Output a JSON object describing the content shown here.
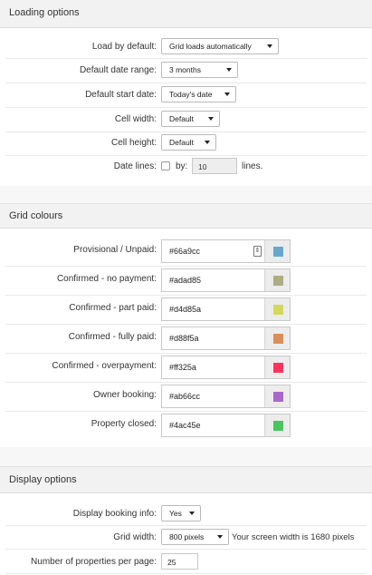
{
  "loading": {
    "title": "Loading options",
    "load_by_default": {
      "label": "Load by default:",
      "value": "Grid loads automatically"
    },
    "default_date_range": {
      "label": "Default date range:",
      "value": "3 months"
    },
    "default_start_date": {
      "label": "Default start date:",
      "value": "Today's date"
    },
    "cell_width": {
      "label": "Cell width:",
      "value": "Default"
    },
    "cell_height": {
      "label": "Cell height:",
      "value": "Default"
    },
    "date_lines": {
      "label": "Date lines:",
      "by_label": "by:",
      "value": "10",
      "suffix": "lines."
    }
  },
  "colours": {
    "title": "Grid colours",
    "items": [
      {
        "label": "Provisional / Unpaid:",
        "value": "#66a9cc",
        "swatch": "#66a9cc"
      },
      {
        "label": "Confirmed - no payment:",
        "value": "#adad85",
        "swatch": "#adad85"
      },
      {
        "label": "Confirmed - part paid:",
        "value": "#d4d85a",
        "swatch": "#d4d85a"
      },
      {
        "label": "Confirmed - fully paid:",
        "value": "#d88f5a",
        "swatch": "#d88f5a"
      },
      {
        "label": "Confirmed - overpayment:",
        "value": "#ff325a",
        "swatch": "#ff325a"
      },
      {
        "label": "Owner booking:",
        "value": "#ab66cc",
        "swatch": "#ab66cc"
      },
      {
        "label": "Property closed:",
        "value": "#4ac45e",
        "swatch": "#4ac45e"
      }
    ]
  },
  "display": {
    "title": "Display options",
    "booking_info": {
      "label": "Display booking info:",
      "value": "Yes"
    },
    "grid_width": {
      "label": "Grid width:",
      "value": "800 pixels",
      "note": "Your screen width is 1680 pixels"
    },
    "properties_per_page": {
      "label": "Number of properties per page:",
      "value": "25"
    }
  }
}
